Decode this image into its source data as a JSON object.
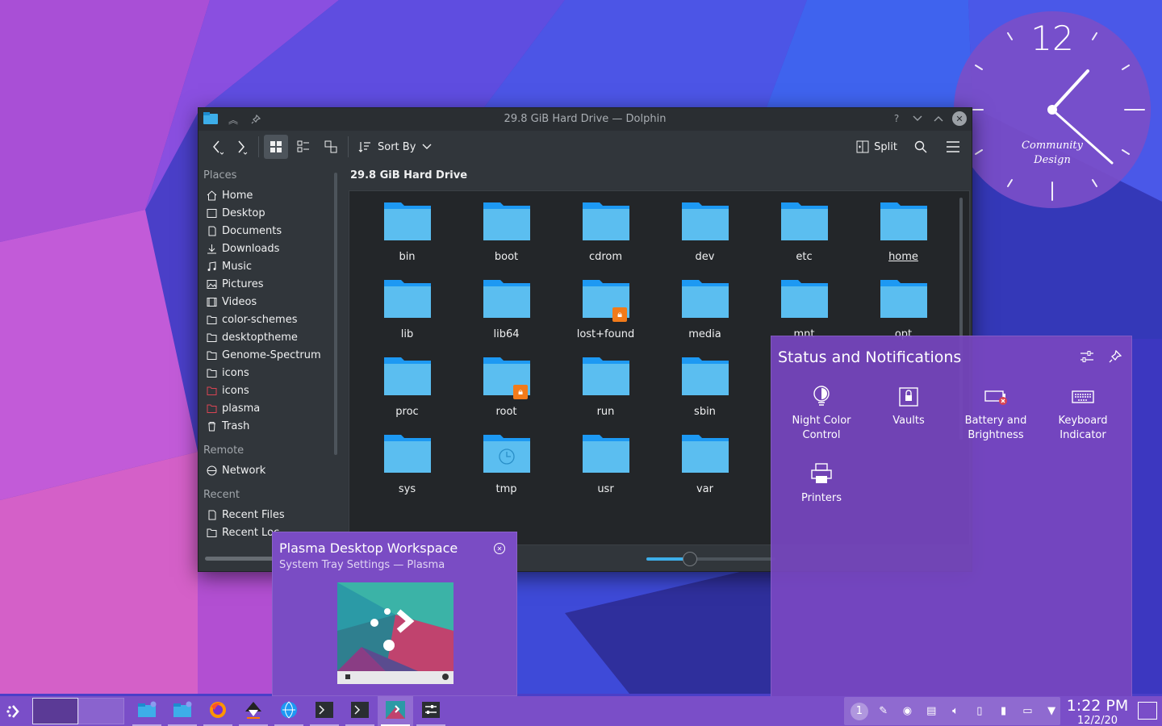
{
  "desktop": {
    "clock_widget": {
      "hour_label": "12",
      "brand_line1": "Community",
      "brand_line2": "Design"
    }
  },
  "dolphin": {
    "window_title": "29.8 GiB Hard Drive — Dolphin",
    "toolbar": {
      "sort_label": "Sort By",
      "split_label": "Split"
    },
    "places": {
      "heading": "Places",
      "items": [
        {
          "label": "Home",
          "icon": "home-icon"
        },
        {
          "label": "Desktop",
          "icon": "desktop-icon"
        },
        {
          "label": "Documents",
          "icon": "documents-icon"
        },
        {
          "label": "Downloads",
          "icon": "downloads-icon"
        },
        {
          "label": "Music",
          "icon": "music-icon"
        },
        {
          "label": "Pictures",
          "icon": "pictures-icon"
        },
        {
          "label": "Videos",
          "icon": "videos-icon"
        },
        {
          "label": "color-schemes",
          "icon": "folder-icon"
        },
        {
          "label": "desktoptheme",
          "icon": "folder-icon"
        },
        {
          "label": "Genome-Spectrum",
          "icon": "folder-icon"
        },
        {
          "label": "icons",
          "icon": "folder-icon"
        },
        {
          "label": "icons",
          "icon": "folder-red-icon"
        },
        {
          "label": "plasma",
          "icon": "folder-red-icon"
        },
        {
          "label": "Trash",
          "icon": "trash-icon"
        }
      ],
      "remote_heading": "Remote",
      "remote_items": [
        {
          "label": "Network",
          "icon": "network-icon"
        }
      ],
      "recent_heading": "Recent",
      "recent_items": [
        {
          "label": "Recent Files",
          "icon": "recent-files-icon"
        },
        {
          "label": "Recent Loc",
          "icon": "recent-locations-icon"
        }
      ]
    },
    "location_title": "29.8 GiB Hard Drive",
    "files": [
      {
        "name": "bin"
      },
      {
        "name": "boot"
      },
      {
        "name": "cdrom"
      },
      {
        "name": "dev"
      },
      {
        "name": "etc"
      },
      {
        "name": "home"
      },
      {
        "name": "lib"
      },
      {
        "name": "lib64"
      },
      {
        "name": "lost+found",
        "locked": true
      },
      {
        "name": "media"
      },
      {
        "name": "mnt"
      },
      {
        "name": "opt"
      },
      {
        "name": "proc"
      },
      {
        "name": "root",
        "locked": true
      },
      {
        "name": "run"
      },
      {
        "name": "sbin"
      },
      {
        "name": ""
      },
      {
        "name": ""
      },
      {
        "name": "sys"
      },
      {
        "name": "tmp"
      },
      {
        "name": "usr"
      },
      {
        "name": "var"
      },
      {
        "name": ""
      },
      {
        "name": ""
      }
    ],
    "accent": "#3daee9",
    "folder_color": "#5bbef0"
  },
  "status_popup": {
    "title": "Status and Notifications",
    "applets": [
      {
        "label": "Night Color Control",
        "icon": "night-color-icon"
      },
      {
        "label": "Vaults",
        "icon": "vault-icon"
      },
      {
        "label": "Battery and Brightness",
        "icon": "battery-icon"
      },
      {
        "label": "Keyboard Indicator",
        "icon": "keyboard-icon"
      },
      {
        "label": "Printers",
        "icon": "printer-icon"
      }
    ]
  },
  "tooltip": {
    "title": "Plasma Desktop Workspace",
    "subtitle": "System Tray Settings — Plasma"
  },
  "taskbar": {
    "time": "1:22 PM",
    "date": "12/2/20",
    "notification_count": "1",
    "tasks": [
      {
        "icon": "dolphin-icon"
      },
      {
        "icon": "dolphin-icon"
      },
      {
        "icon": "firefox-icon"
      },
      {
        "icon": "inkscape-icon"
      },
      {
        "icon": "browser-icon"
      },
      {
        "icon": "konsole-icon"
      },
      {
        "icon": "konsole-icon"
      },
      {
        "icon": "plasma-settings-icon",
        "active": true
      },
      {
        "icon": "system-settings-icon"
      }
    ]
  }
}
